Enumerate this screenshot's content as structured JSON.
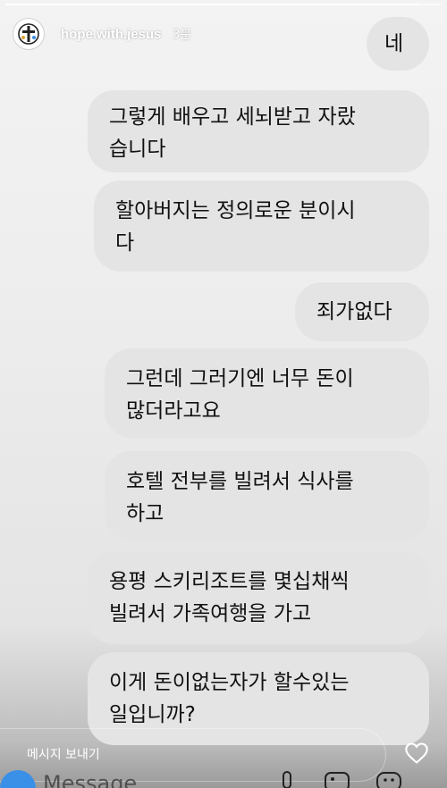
{
  "story": {
    "username": "hope.with.jesus",
    "timestamp": "3분",
    "progress": 0.95
  },
  "messages": [
    {
      "side": "right",
      "text": "네"
    },
    {
      "side": "left",
      "text": "그렇게 배우고 세뇌받고 자랐\n습니다"
    },
    {
      "side": "left",
      "text": "할아버지는 정의로운 분이시\n다"
    },
    {
      "side": "right",
      "text": "죄가없다"
    },
    {
      "side": "left",
      "text": "그런데 그러기엔 너무 돈이\n많더라고요"
    },
    {
      "side": "left",
      "text": "호텔 전부를 빌려서 식사를\n하고"
    },
    {
      "side": "left",
      "text": "용평 스키리조트를 몇십채씩\n빌려서 가족여행을 가고"
    },
    {
      "side": "left",
      "text": "이게 돈이없는자가 할수있는\n일입니까?"
    }
  ],
  "reply": {
    "label": "메시지 보내기",
    "placeholder": "Message"
  },
  "icons": {
    "avatar": "cross-logo-icon",
    "like": "heart-outline-icon",
    "camera": "camera-icon",
    "mic": "microphone-icon",
    "gallery": "image-icon",
    "sticker": "sticker-icon"
  },
  "colors": {
    "bubble": "#e4e4e4",
    "text": "#111111",
    "camera": "#3a8fe6"
  }
}
